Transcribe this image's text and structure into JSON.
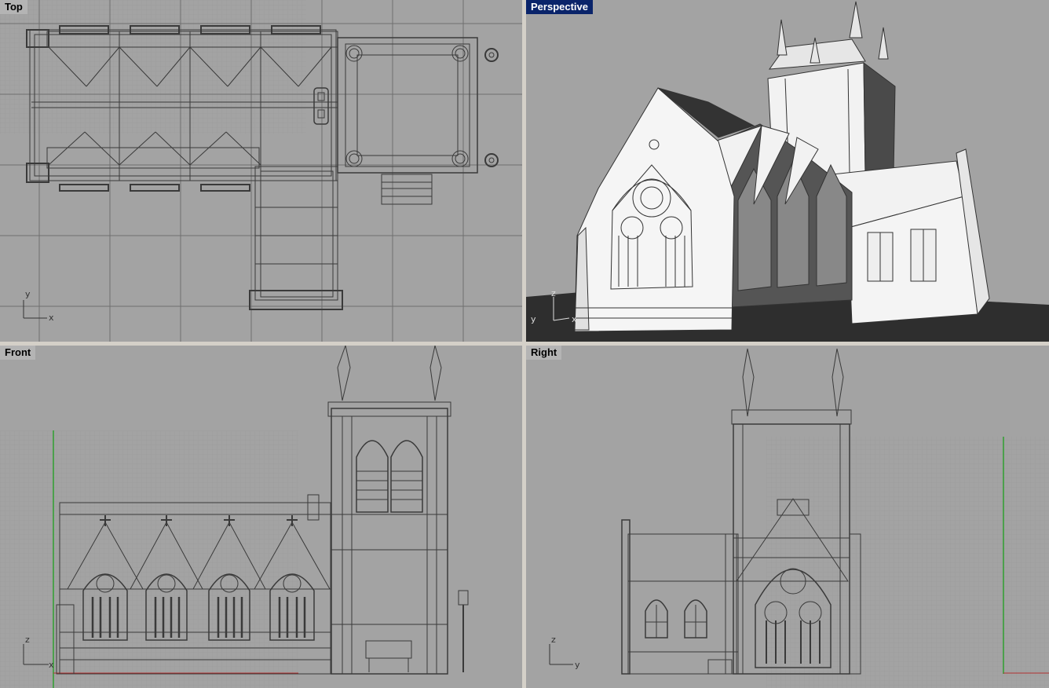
{
  "viewports": {
    "top": {
      "label": "Top",
      "axis_h": "x",
      "axis_v": "y"
    },
    "perspective": {
      "label": "Perspective",
      "axis_h": "x",
      "axis_v": "z",
      "axis_d": "y"
    },
    "front": {
      "label": "Front",
      "axis_h": "x",
      "axis_v": "z"
    },
    "right": {
      "label": "Right",
      "axis_h": "y",
      "axis_v": "z"
    }
  },
  "colors": {
    "viewport_bg": "#a3a3a3",
    "grid": "#8e8e8e",
    "grid_major": "#6f6f6f",
    "wire": "#3a3a3a",
    "active_label": "#0a246a",
    "frame": "#d4d0c8",
    "shade_light": "#f2f2f2",
    "shade_dark": "#2e2e2e",
    "z_axis": "#2fa02f",
    "x_axis": "#b03030"
  }
}
